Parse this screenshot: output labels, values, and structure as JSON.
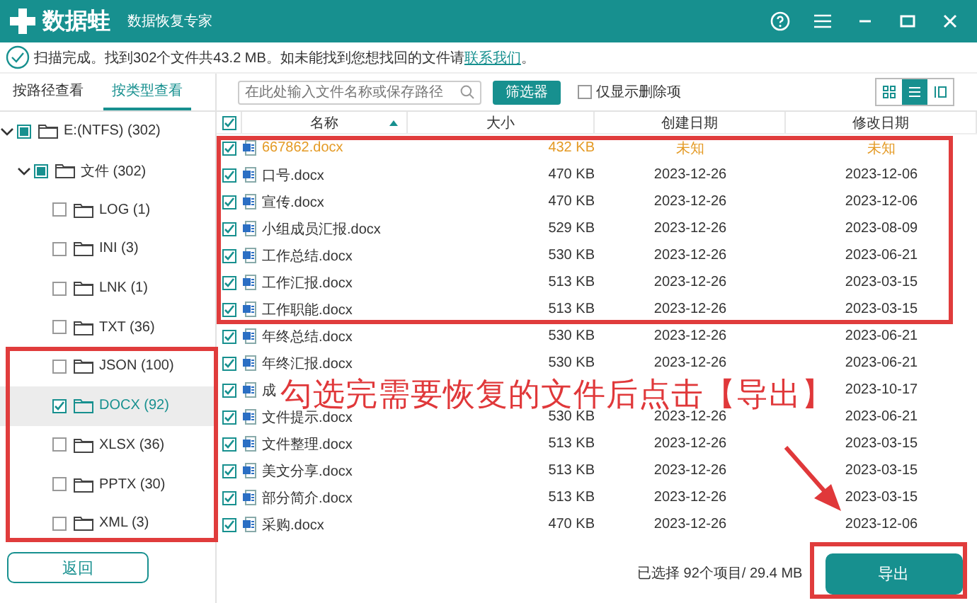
{
  "window": {
    "app_name": "数据蛙",
    "subtitle": "数据恢复专家"
  },
  "notice": {
    "text": "扫描完成。找到302个文件共43.2 MB。如未能找到您想找回的文件请",
    "link": "联系我们",
    "end": "。"
  },
  "tabs": [
    {
      "label": "按路径查看",
      "selected": false
    },
    {
      "label": "按类型查看",
      "selected": true
    }
  ],
  "search": {
    "placeholder": "在此处输入文件名称或保存路径"
  },
  "filter_button": "筛选器",
  "deleted_only": {
    "label": "仅显示删除项",
    "checked": false
  },
  "view_modes": [
    {
      "kind": "grid",
      "selected": false
    },
    {
      "kind": "list",
      "selected": true
    },
    {
      "kind": "detail",
      "selected": false
    }
  ],
  "tree": [
    {
      "label": "E:(NTFS) (302)",
      "partial": true,
      "expanded": true,
      "selected": false,
      "children": [
        {
          "label": "文件 (302)",
          "partial": true,
          "expanded": true,
          "selected": false,
          "children": [
            {
              "label": "LOG (1)",
              "checked": false,
              "selected": false
            },
            {
              "label": "INI (3)",
              "checked": false,
              "selected": false
            },
            {
              "label": "LNK (1)",
              "checked": false,
              "selected": false
            },
            {
              "label": "TXT (36)",
              "checked": false,
              "selected": false
            },
            {
              "label": "JSON (100)",
              "checked": false,
              "selected": false
            },
            {
              "label": "DOCX (92)",
              "checked": true,
              "selected": true
            },
            {
              "label": "XLSX (36)",
              "checked": false,
              "selected": false
            },
            {
              "label": "PPTX (30)",
              "checked": false,
              "selected": false
            },
            {
              "label": "XML (3)",
              "checked": false,
              "selected": false
            }
          ]
        }
      ]
    }
  ],
  "back_button": "返回",
  "table": {
    "all_checked": true,
    "columns": [
      "名称",
      "大小",
      "创建日期",
      "修改日期"
    ],
    "rows": [
      {
        "name": "667862.docx",
        "size": "432 KB",
        "created": "未知",
        "modified": "未知",
        "checked": true,
        "highlighted": true
      },
      {
        "name": "口号.docx",
        "size": "470 KB",
        "created": "2023-12-26",
        "modified": "2023-12-06",
        "checked": true,
        "highlighted": false
      },
      {
        "name": "宣传.docx",
        "size": "470 KB",
        "created": "2023-12-26",
        "modified": "2023-12-06",
        "checked": true,
        "highlighted": false
      },
      {
        "name": "小组成员汇报.docx",
        "size": "529 KB",
        "created": "2023-12-26",
        "modified": "2023-08-09",
        "checked": true,
        "highlighted": false
      },
      {
        "name": "工作总结.docx",
        "size": "530 KB",
        "created": "2023-12-26",
        "modified": "2023-06-21",
        "checked": true,
        "highlighted": false
      },
      {
        "name": "工作汇报.docx",
        "size": "513 KB",
        "created": "2023-12-26",
        "modified": "2023-03-15",
        "checked": true,
        "highlighted": false
      },
      {
        "name": "工作职能.docx",
        "size": "513 KB",
        "created": "2023-12-26",
        "modified": "2023-03-15",
        "checked": true,
        "highlighted": false
      },
      {
        "name": "年终总结.docx",
        "size": "530 KB",
        "created": "2023-12-26",
        "modified": "2023-06-21",
        "checked": true,
        "highlighted": false
      },
      {
        "name": "年终汇报.docx",
        "size": "530 KB",
        "created": "2023-12-26",
        "modified": "2023-06-21",
        "checked": true,
        "highlighted": false
      },
      {
        "name": "成",
        "modified": "2023-10-17",
        "checked": true,
        "highlighted": false
      },
      {
        "name": "文件提示.docx",
        "size": "530 KB",
        "created": "2023-12-26",
        "modified": "2023-06-21",
        "checked": true,
        "highlighted": false
      },
      {
        "name": "文件整理.docx",
        "size": "513 KB",
        "created": "2023-12-26",
        "modified": "2023-03-15",
        "checked": true,
        "highlighted": false
      },
      {
        "name": "美文分享.docx",
        "size": "513 KB",
        "created": "2023-12-26",
        "modified": "2023-03-15",
        "checked": true,
        "highlighted": false
      },
      {
        "name": "部分简介.docx",
        "size": "513 KB",
        "created": "2023-12-26",
        "modified": "2023-03-15",
        "checked": true,
        "highlighted": false
      },
      {
        "name": "采购.docx",
        "size": "470 KB",
        "created": "2023-12-26",
        "modified": "2023-12-06",
        "checked": true,
        "highlighted": false
      }
    ]
  },
  "selection_summary": "已选择 92个项目/ 29.4 MB",
  "export_button": "导出",
  "annotation": {
    "text": "勾选完需要恢复的文件后点击【导出】"
  }
}
